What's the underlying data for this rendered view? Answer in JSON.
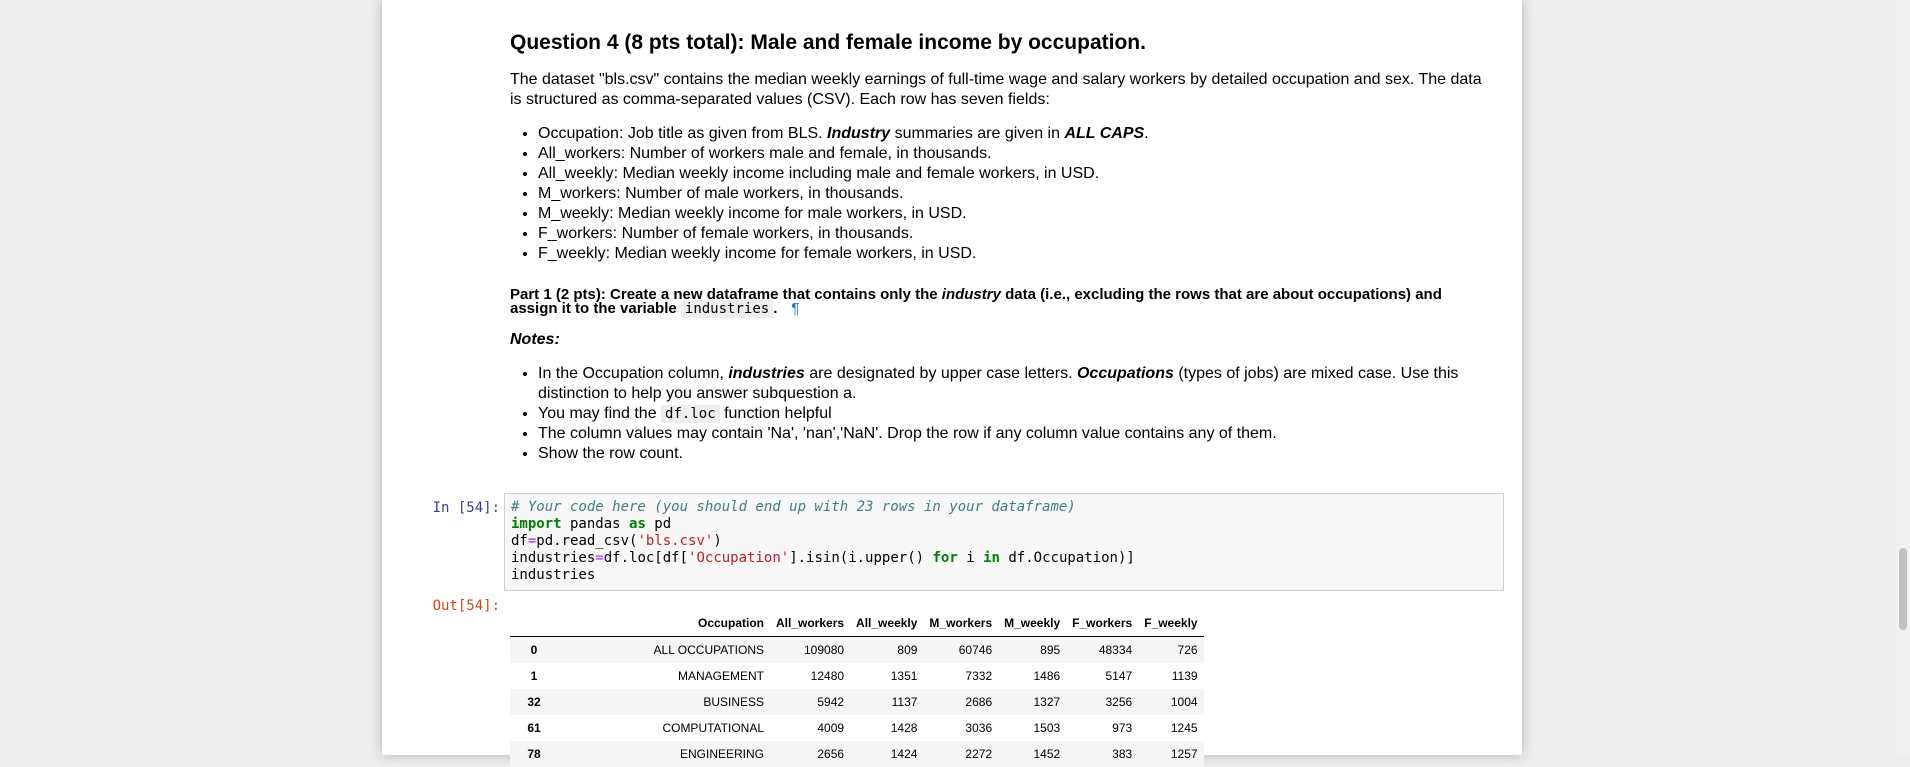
{
  "question": {
    "title": "Question 4 (8 pts total): Male and female income by occupation.",
    "intro": "The dataset \"bls.csv\" contains the median weekly earnings of full-time wage and salary workers by detailed occupation and sex. The data is structured as comma-separated values (CSV). Each row has seven fields:",
    "field0_pre": "Occupation: Job title as given from BLS. ",
    "field0_industry": "Industry",
    "field0_mid": " summaries are given in ",
    "field0_caps": "ALL CAPS",
    "field0_end": ".",
    "fields": [
      "All_workers: Number of workers male and female, in thousands.",
      "All_weekly: Median weekly income including male and female workers, in USD.",
      "M_workers: Number of male workers, in thousands.",
      "M_weekly: Median weekly income for male workers, in USD.",
      "F_workers: Number of female workers, in thousands.",
      "F_weekly: Median weekly income for female workers, in USD."
    ]
  },
  "part1": {
    "pre": "Part 1 (2 pts): Create a new dataframe that contains only the ",
    "industry": "industry",
    "mid": " data (i.e., excluding the rows that are about occupations) and assign it to the variable ",
    "var": "industries",
    "end": ".",
    "pilcrow": "¶"
  },
  "notes": {
    "heading": "Notes:",
    "n1_a": "In the Occupation column, ",
    "n1_b": "industries",
    "n1_c": " are designated by upper case letters. ",
    "n1_d": "Occupations",
    "n1_e": " (types of jobs) are mixed case. Use this distinction to help you answer subquestion a.",
    "n2_a": "You may find the ",
    "n2_code": "df.loc",
    "n2_b": " function helpful",
    "n3": "The column values may contain 'Na', 'nan','NaN'. Drop the row if any column value contains any of them.",
    "n4": "Show the row count."
  },
  "cell": {
    "in_prompt": "In [54]:",
    "out_prompt": "Out[54]:",
    "comment": "# Your code here (you should end up with 23 rows in your dataframe)",
    "kw_import": "import",
    "mod_pandas": " pandas ",
    "kw_as": "as",
    "alias_pd": " pd",
    "l2_a": "df",
    "l2_eq": "=",
    "l2_b": "pd.read_csv(",
    "l2_str": "'bls.csv'",
    "l2_c": ")",
    "l3_a": "industries",
    "l3_eq": "=",
    "l3_b": "df.loc[df[",
    "l3_str": "'Occupation'",
    "l3_c": "].isin(i.upper() ",
    "kw_for": "for",
    "l3_d": " i ",
    "kw_in": "in",
    "l3_e": " df.Occupation)]",
    "l4": "industries"
  },
  "dataframe": {
    "columns": [
      "Occupation",
      "All_workers",
      "All_weekly",
      "M_workers",
      "M_weekly",
      "F_workers",
      "F_weekly"
    ],
    "rows": [
      {
        "index": "0",
        "values": [
          "ALL OCCUPATIONS",
          "109080",
          "809",
          "60746",
          "895",
          "48334",
          "726"
        ]
      },
      {
        "index": "1",
        "values": [
          "MANAGEMENT",
          "12480",
          "1351",
          "7332",
          "1486",
          "5147",
          "1139"
        ]
      },
      {
        "index": "32",
        "values": [
          "BUSINESS",
          "5942",
          "1137",
          "2686",
          "1327",
          "3256",
          "1004"
        ]
      },
      {
        "index": "61",
        "values": [
          "COMPUTATIONAL",
          "4009",
          "1428",
          "3036",
          "1503",
          "973",
          "1245"
        ]
      },
      {
        "index": "78",
        "values": [
          "ENGINEERING",
          "2656",
          "1424",
          "2272",
          "1452",
          "383",
          "1257"
        ]
      }
    ]
  }
}
